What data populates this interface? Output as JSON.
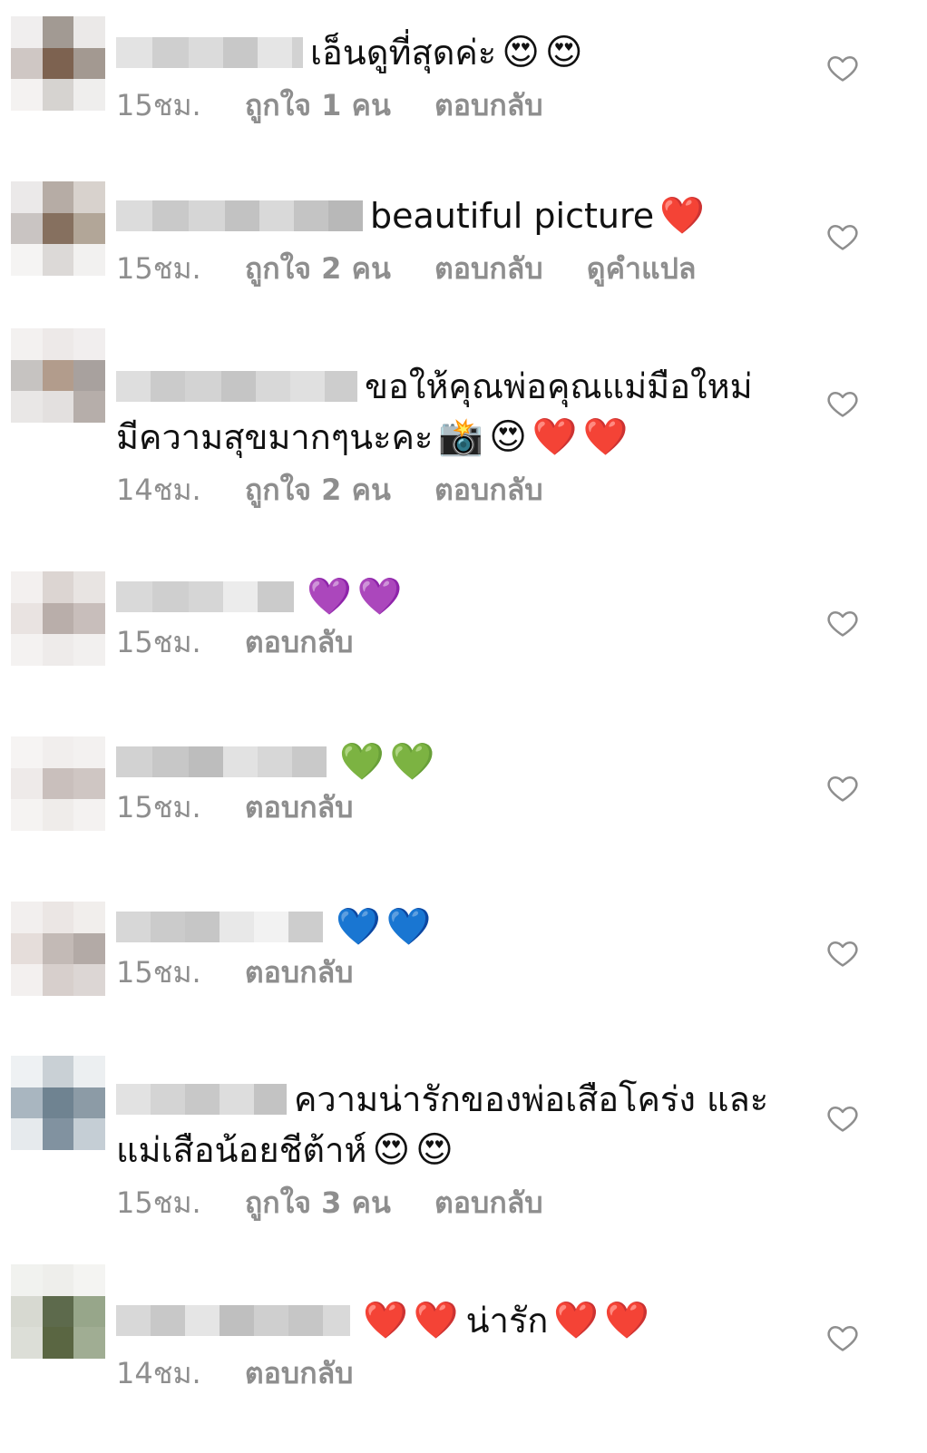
{
  "comments": [
    {
      "text": "เอ็นดูที่สุดค่ะ",
      "text2": "",
      "emojis": [
        "😍",
        "😍"
      ],
      "time": "15ชม.",
      "likes": "ถูกใจ 1 คน",
      "reply": "ตอบกลับ",
      "translate": ""
    },
    {
      "text": "beautiful picture",
      "text2": "",
      "emojis": [
        "❤️"
      ],
      "time": "15ชม.",
      "likes": "ถูกใจ 2 คน",
      "reply": "ตอบกลับ",
      "translate": "ดูคำแปล"
    },
    {
      "text": "ขอให้คุณพ่อคุณแม่มือใหม่",
      "text2": "มีความสุขมากๆนะคะ",
      "emojis": [
        "📸",
        "😍",
        "❤️",
        "❤️"
      ],
      "time": "14ชม.",
      "likes": "ถูกใจ 2 คน",
      "reply": "ตอบกลับ",
      "translate": ""
    },
    {
      "text": "",
      "text2": "",
      "emojis": [
        "💜",
        "💜"
      ],
      "time": "15ชม.",
      "likes": "",
      "reply": "ตอบกลับ",
      "translate": ""
    },
    {
      "text": "",
      "text2": "",
      "emojis": [
        "💚",
        "💚"
      ],
      "time": "15ชม.",
      "likes": "",
      "reply": "ตอบกลับ",
      "translate": ""
    },
    {
      "text": "",
      "text2": "",
      "emojis": [
        "💙",
        "💙"
      ],
      "time": "15ชม.",
      "likes": "",
      "reply": "ตอบกลับ",
      "translate": ""
    },
    {
      "text": "ความน่ารักของพ่อเสือโคร่ง และ",
      "text2": "แม่เสือน้อยชีต้าห์",
      "emojis": [
        "😍",
        "😍"
      ],
      "time": "15ชม.",
      "likes": "ถูกใจ 3 คน",
      "reply": "ตอบกลับ",
      "translate": ""
    },
    {
      "text": "น่ารัก",
      "text2": "",
      "emojis": [
        "❤️",
        "❤️",
        "❤️",
        "❤️"
      ],
      "time": "14ชม.",
      "likes": "",
      "reply": "ตอบกลับ",
      "translate": ""
    }
  ],
  "icons": {
    "like": "heart-outline-icon",
    "avatar": "pixelated-avatar",
    "username": "blurred-username"
  },
  "colors": {
    "meta": "#8e8e8e",
    "text": "#111111",
    "icon": "#8e8e8e"
  }
}
